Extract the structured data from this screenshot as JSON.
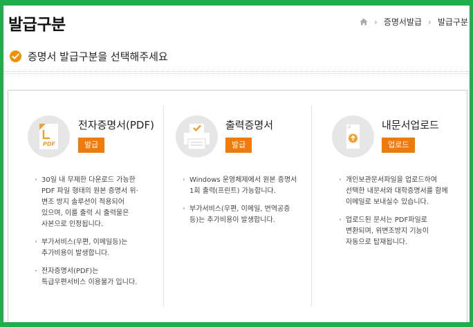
{
  "page": {
    "title": "발급구분",
    "breadcrumb": [
      "증명서발급",
      "발급구분"
    ]
  },
  "heading": "증명서 발급구분을 선택해주세요",
  "colors": {
    "accent": "#f07a0a",
    "check": "#f29100",
    "frame": "#1fae4b"
  },
  "options": [
    {
      "title": "전자증명서(PDF)",
      "icon": "pdf-document-icon",
      "icon_label": "PDF",
      "button": "발급",
      "notes": [
        "30일 내 무제한 다운로드 가능한 PDF 파일 형태의 원본 증명서 위·변조 방지 솔루션이 적용되어 있으며, 이를 출력 시 출력물은 사본으로 인정됩니다.",
        "부가서비스(우편, 이메일등)는 추가비용이 발생합니다.",
        "전자증명서(PDF)는 특급우편서비스 이용불가 입니다."
      ]
    },
    {
      "title": "출력증명서",
      "icon": "printer-icon",
      "button": "발급",
      "notes": [
        "Windows 운영체제에서 원본 증명서 1회 출력(프린트) 가능합니다.",
        "부가서비스(우편, 이메일, 번역공증 등)는 추가비용이 발생합니다."
      ]
    },
    {
      "title": "내문서업로드",
      "icon": "upload-document-icon",
      "button": "업로드",
      "notes": [
        "개인보관문서파일을 업로드하여 선택한 내문서와 대학증명서를 함께 이메일로 보내실수 있습니다.",
        "업로드된 문서는 PDF파일로 변환되며, 위변조방지 기능이 자동으로 탑재됩니다."
      ]
    }
  ]
}
